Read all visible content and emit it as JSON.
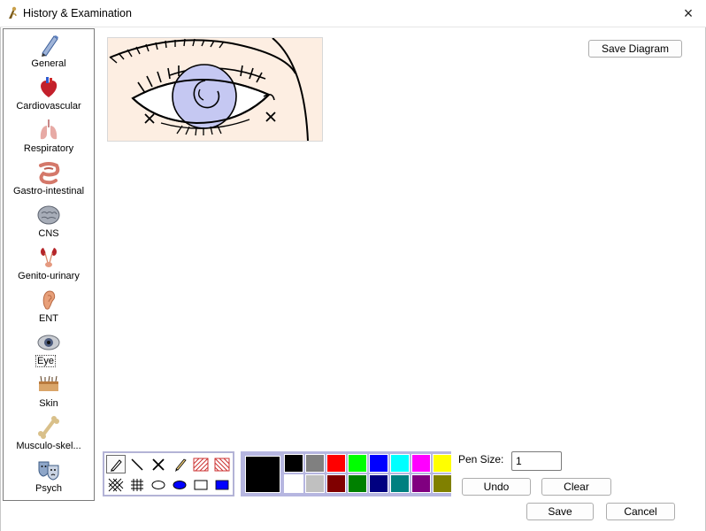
{
  "window": {
    "title": "History & Examination",
    "close_icon": "×"
  },
  "sidebar": {
    "items": [
      {
        "label": "General",
        "icon": "pencil-icon"
      },
      {
        "label": "Cardiovascular",
        "icon": "heart-icon"
      },
      {
        "label": "Respiratory",
        "icon": "lungs-icon"
      },
      {
        "label": "Gastro-intestinal",
        "icon": "intestine-icon"
      },
      {
        "label": "CNS",
        "icon": "brain-icon"
      },
      {
        "label": "Genito-urinary",
        "icon": "kidney-icon"
      },
      {
        "label": "ENT",
        "icon": "ear-icon"
      },
      {
        "label": "Eye",
        "icon": "eye-icon"
      },
      {
        "label": "Skin",
        "icon": "skin-icon"
      },
      {
        "label": "Musculo-skel...",
        "icon": "bone-icon"
      },
      {
        "label": "Psych",
        "icon": "theatre-masks-icon"
      }
    ],
    "selected": "Eye"
  },
  "diagram": {
    "save_label": "Save Diagram"
  },
  "drawing_tools": {
    "tools": [
      "pencil",
      "line",
      "cross",
      "brush",
      "hatch-red-forward",
      "hatch-red-back",
      "crosshatch-diagonal",
      "grid",
      "ellipse-outline",
      "ellipse-filled",
      "rectangle-outline",
      "rectangle-filled"
    ],
    "selected": "pencil"
  },
  "palette": {
    "current_color": "#000000",
    "colors": [
      "#000000",
      "#808080",
      "#ff0000",
      "#00ff00",
      "#0000ff",
      "#00ffff",
      "#ff00ff",
      "#ffff00",
      "#ffffff",
      "#c0c0c0",
      "#800000",
      "#008000",
      "#000080",
      "#008080",
      "#800080",
      "#808000"
    ]
  },
  "pen": {
    "label": "Pen Size:",
    "value": "1"
  },
  "actions": {
    "undo": "Undo",
    "clear": "Clear",
    "save": "Save",
    "cancel": "Cancel"
  }
}
